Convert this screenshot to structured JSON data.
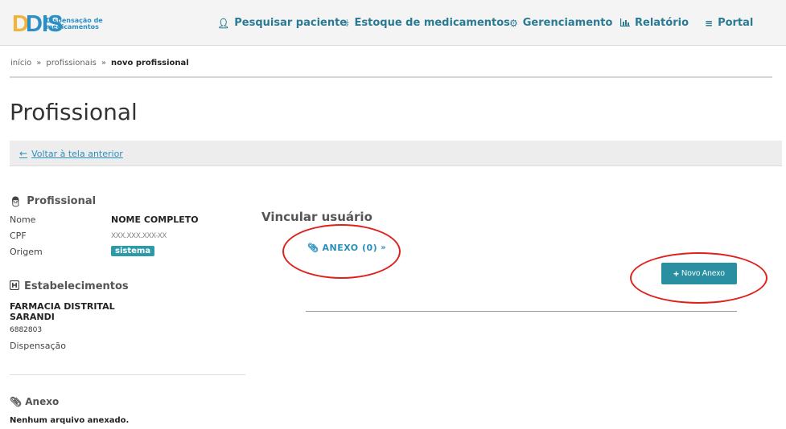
{
  "header": {
    "logo_main": "DIS",
    "logo_sub_1": "Dispensação de",
    "logo_sub_2": "medicamentos",
    "nav": [
      {
        "label": "Pesquisar paciente",
        "icon": "user-icon"
      },
      {
        "label": "Estoque de medicamentos",
        "icon": "medkit-icon"
      },
      {
        "label": "Gerenciamento",
        "icon": "gear-icon"
      },
      {
        "label": "Relatório",
        "icon": "bar-chart-icon"
      },
      {
        "label": "Portal",
        "icon": "menu-icon"
      }
    ]
  },
  "breadcrumb": {
    "items": [
      "início",
      "profissionais"
    ],
    "current": "novo profissional",
    "separator": "»"
  },
  "page_title": "Profissional",
  "back_link": "Voltar à tela anterior",
  "profissional": {
    "section_title": "Profissional",
    "nome_label": "Nome",
    "nome_value": "NOME COMPLETO",
    "cpf_label": "CPF",
    "cpf_value": "XXX.XXX.XXX-XX",
    "origem_label": "Origem",
    "origem_value": "sistema"
  },
  "estabelecimentos": {
    "section_title": "Estabelecimentos",
    "name_line_1": "FARMACIA DISTRITAL",
    "name_line_2": "SARANDI",
    "code": "6882803",
    "type": "Dispensação"
  },
  "anexo_left": {
    "title": "Anexo",
    "empty": "Nenhum arquivo anexado."
  },
  "vincular": {
    "title": "Vincular usuário",
    "anexo_toggle": "ANEXO (0)",
    "novo_anexo": "Novo Anexo"
  },
  "colors": {
    "accent": "#2a8fa0",
    "link": "#2a8fbd",
    "annotation": "#e0211b"
  }
}
